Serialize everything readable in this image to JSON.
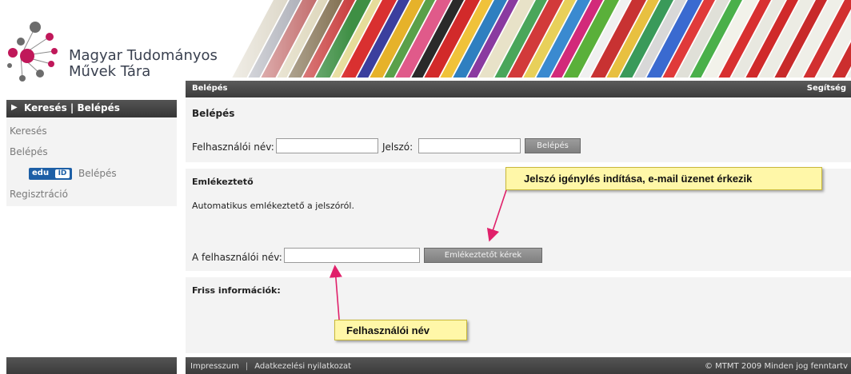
{
  "brand": {
    "title_line1": "Magyar Tudományos",
    "title_line2": "Művek Tára"
  },
  "topbar": {
    "left_title": "Belépés",
    "help_link": "Segítség"
  },
  "sidebar": {
    "header": "Keresés | Belépés",
    "items": [
      {
        "label": "Keresés"
      },
      {
        "label": "Belépés"
      },
      {
        "label": "Belépés",
        "badge_left": "edu",
        "badge_right": "ID"
      },
      {
        "label": "Regisztráció"
      }
    ]
  },
  "login": {
    "title": "Belépés",
    "username_label": "Felhasználói név:",
    "username_value": "",
    "password_label": "Jelszó:",
    "password_value": "",
    "submit_label": "Belépés"
  },
  "reminder": {
    "title": "Emlékeztető",
    "description": "Automatikus emlékeztető a jelszóról.",
    "username_label": "A felhasználói név:",
    "username_value": "",
    "submit_label": "Emlékeztetőt kérek"
  },
  "news": {
    "title": "Friss információk:"
  },
  "footer": {
    "link_impressum": "Impresszum",
    "separator": "|",
    "link_privacy": "Adatkezelési nyilatkozat",
    "copyright": "© MTMT 2009 Minden jog fenntartv"
  },
  "annotations": {
    "callout_1": "Jelszó igénylés indítása, e-mail üzenet érkezik",
    "callout_2": "Felhasználói név"
  },
  "colors": {
    "dark_bar": "#444444",
    "panel_bg": "#f3f3f3",
    "button": "#8e8e8e",
    "callout_bg": "#fff7a8",
    "arrow": "#e0206a",
    "logo_magenta": "#c0185a",
    "logo_gray": "#6c6c6c"
  }
}
